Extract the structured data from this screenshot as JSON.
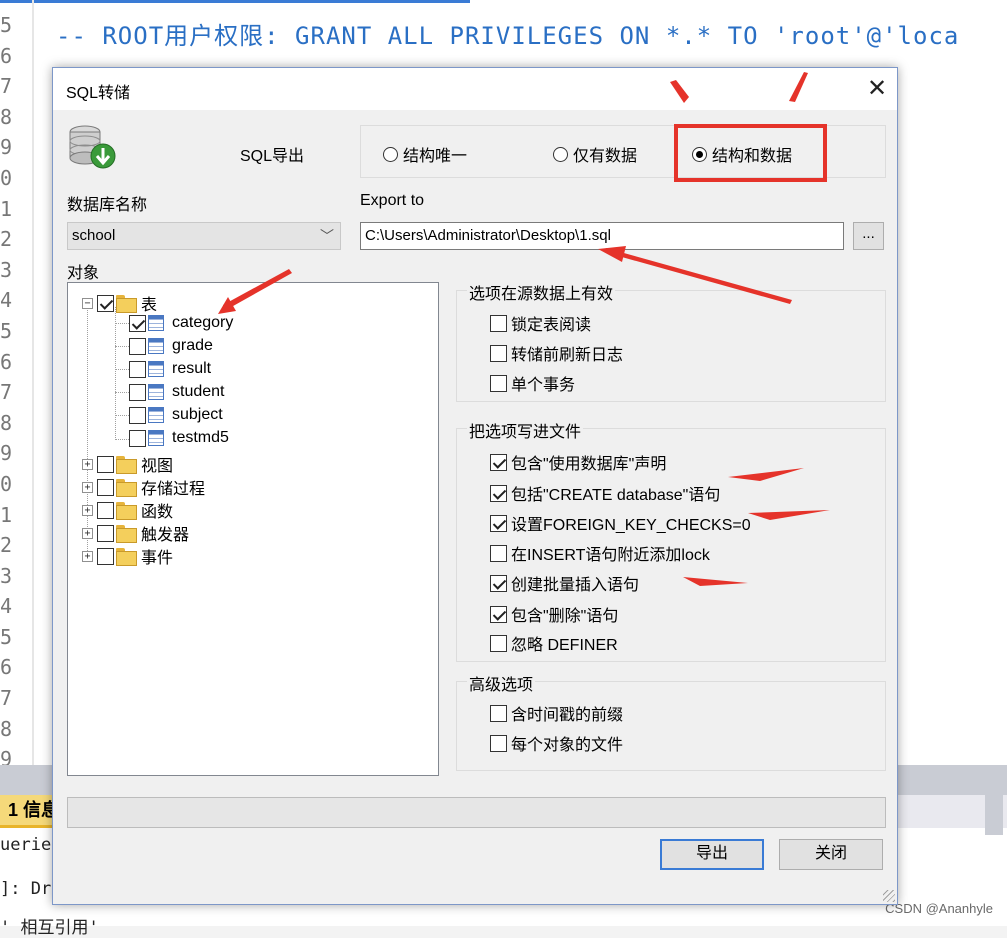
{
  "background": {
    "line_numbers": [
      "5",
      "6",
      "7",
      "8",
      "9",
      "0",
      "1",
      "2",
      "3",
      "4",
      "5",
      "6",
      "7",
      "8",
      "9",
      "0",
      "1",
      "2",
      "3",
      "4",
      "5",
      "6",
      "7",
      "8",
      "9"
    ],
    "sql_comment": "-- ROOT用户权限: GRANT ALL PRIVILEGES ON *.* TO 'root'@'loca",
    "info_tab": "1 信息",
    "output_line1": "uerie",
    "output_line2": "]: Dr",
    "output_line3": "' 相互引用'",
    "watermark": "CSDN @Ananhyle"
  },
  "dialog": {
    "title": "SQL转储",
    "close_glyph": "✕",
    "export_label": "SQL导出",
    "radio_options": [
      {
        "label": "结构唯一",
        "selected": false
      },
      {
        "label": "仅有数据",
        "selected": false
      },
      {
        "label": "结构和数据",
        "selected": true
      }
    ],
    "db_name_label": "数据库名称",
    "db_name_value": "school",
    "export_to_label": "Export to",
    "export_path": "C:\\Users\\Administrator\\Desktop\\1.sql",
    "browse_label": "...",
    "objects_label": "对象",
    "tree": {
      "root": {
        "label": "表",
        "checked": true,
        "expanded": true
      },
      "tables": [
        {
          "label": "category",
          "checked": true
        },
        {
          "label": "grade",
          "checked": false
        },
        {
          "label": "result",
          "checked": false
        },
        {
          "label": "student",
          "checked": false
        },
        {
          "label": "subject",
          "checked": false
        },
        {
          "label": "testmd5",
          "checked": false
        }
      ],
      "folders": [
        {
          "label": "视图",
          "checked": false
        },
        {
          "label": "存储过程",
          "checked": false
        },
        {
          "label": "函数",
          "checked": false
        },
        {
          "label": "触发器",
          "checked": false
        },
        {
          "label": "事件",
          "checked": false
        }
      ]
    },
    "source_options_title": "选项在源数据上有效",
    "source_options": [
      {
        "label": "锁定表阅读",
        "checked": false
      },
      {
        "label": "转储前刷新日志",
        "checked": false
      },
      {
        "label": "单个事务",
        "checked": false
      }
    ],
    "file_options_title": "把选项写进文件",
    "file_options": [
      {
        "label": "包含\"使用数据库\"声明",
        "checked": true
      },
      {
        "label": "包括\"CREATE database\"语句",
        "checked": true
      },
      {
        "label": "设置FOREIGN_KEY_CHECKS=0",
        "checked": true
      },
      {
        "label": "在INSERT语句附近添加lock",
        "checked": false
      },
      {
        "label": "创建批量插入语句",
        "checked": true
      },
      {
        "label": "包含\"删除\"语句",
        "checked": true
      },
      {
        "label": "忽略 DEFINER",
        "checked": false
      }
    ],
    "advanced_title": "高级选项",
    "advanced_options": [
      {
        "label": "含时间戳的前缀",
        "checked": false
      },
      {
        "label": "每个对象的文件",
        "checked": false
      }
    ],
    "export_button": "导出",
    "close_button": "关闭"
  },
  "colors": {
    "annotation_red": "#e5332a",
    "sql_blue": "#2a6fc4",
    "primary_border": "#3a7bd5"
  }
}
